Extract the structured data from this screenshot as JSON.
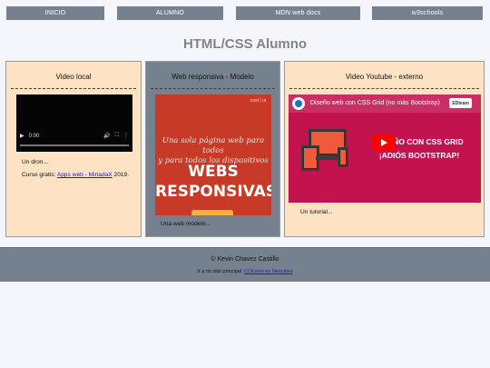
{
  "nav": {
    "items": [
      {
        "label": "INICIO"
      },
      {
        "label": "ALUMNO"
      },
      {
        "label": "MDN web docs"
      },
      {
        "label": "w3schools"
      }
    ]
  },
  "header": {
    "title": "HTML/CSS Alumno"
  },
  "cards": {
    "video_local": {
      "title": "Video local",
      "time": "0:00",
      "caption": "Un dron...",
      "course_prefix": "Curso gratis: ",
      "course_link": "Apps web - MiriadaX",
      "course_suffix": " 2019."
    },
    "responsive": {
      "title": "Web responsiva - Modelo",
      "poster_tag": "cost | ui",
      "poster_script_1": "Una sola página web para todos",
      "poster_script_2": "y para todos los dispositivos",
      "poster_big_1": "WEBS",
      "poster_big_2": "RESPONSIVAS",
      "caption": "Una web modelo..."
    },
    "youtube": {
      "title": "Video Youtube - externo",
      "video_title": "Diseño web con CSS Grid (no más Bootstrap)",
      "badge": "EDteam",
      "headline_1": "DISEÑO CON CSS GRID",
      "headline_2": "¡ADIÓS BOOTSTRAP!",
      "caption": "Un tutorial..."
    }
  },
  "footer": {
    "copyright": "© Kevin Chavez Castillo",
    "visit_prefix": "Ir a mi sitio principal: ",
    "visit_link": "CCKevin en Neocities"
  },
  "colors": {
    "nav_bg": "#75818f",
    "card_peach": "#fde3c4",
    "youtube_red": "#ff0000",
    "poster_red": "#c73a27"
  }
}
